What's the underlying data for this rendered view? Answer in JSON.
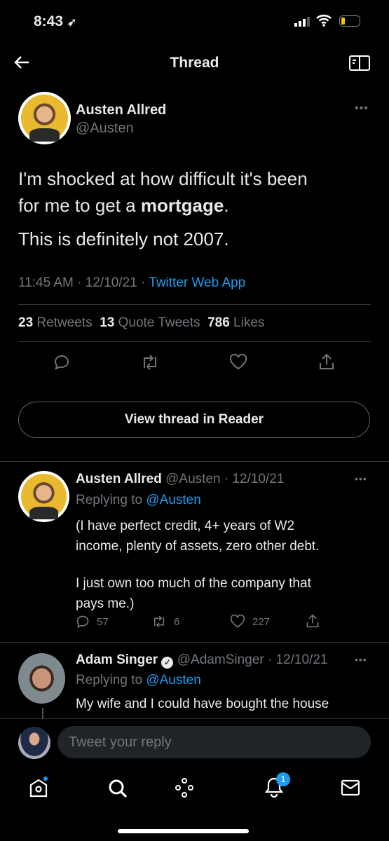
{
  "status": {
    "time": "8:43"
  },
  "header": {
    "title": "Thread"
  },
  "main_tweet": {
    "name": "Austen Allred",
    "handle": "@Austen",
    "text_line1": "I'm shocked at how difficult it's been",
    "text_line2_pre": "for me to get a ",
    "text_line2_bold": "mortgage",
    "text_line2_post": ".",
    "text_line3": "This is definitely not 2007.",
    "time": "11:45 AM · 12/10/21 · ",
    "source": "Twitter Web App",
    "retweets": "23",
    "retweets_label": "Retweets",
    "quotes": "13",
    "quotes_label": "Quote Tweets",
    "likes": "786",
    "likes_label": "Likes"
  },
  "reader_button": "View thread in Reader",
  "replies": [
    {
      "name": "Austen Allred",
      "meta": "@Austen · 12/10/21",
      "replying": "Replying to ",
      "to": "@Austen",
      "line1": "(I have perfect credit, 4+ years of W2",
      "line2": "income, plenty of assets, zero other debt.",
      "line3": "I just own too much of the company that",
      "line4": "pays me.)",
      "replies": "57",
      "retweets": "6",
      "likes": "227"
    },
    {
      "name": "Adam Singer",
      "meta": "@AdamSinger · 12/10/21",
      "replying": "Replying to ",
      "to": "@Austen",
      "line1": "My wife and I could have bought the house"
    }
  ],
  "composer": {
    "placeholder": "Tweet your reply"
  },
  "tabbar": {
    "notifications_badge": "1"
  },
  "colors": {
    "accent": "#1d9bf0",
    "bg": "#000000"
  }
}
